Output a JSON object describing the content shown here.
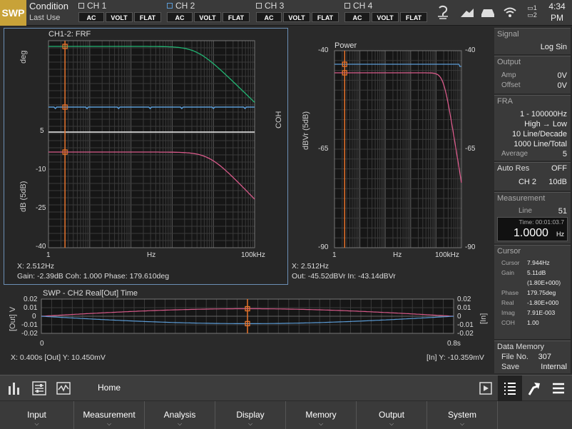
{
  "topbar": {
    "mode": "SWP",
    "condition_title": "Condition",
    "condition_sub": "Last Use",
    "channels": [
      {
        "name": "CH 1",
        "active": false,
        "coupling": "AC",
        "unit": "VOLT",
        "filter": "FLAT"
      },
      {
        "name": "CH 2",
        "active": true,
        "coupling": "AC",
        "unit": "VOLT",
        "filter": "FLAT"
      },
      {
        "name": "CH 3",
        "active": false,
        "coupling": "AC",
        "unit": "VOLT",
        "filter": "FLAT"
      },
      {
        "name": "CH 4",
        "active": false,
        "coupling": "AC",
        "unit": "VOLT",
        "filter": "FLAT"
      }
    ],
    "icons": [
      "usb-icon",
      "signal-icon",
      "storage-icon",
      "wifi-icon",
      "battery-icon"
    ],
    "battery": {
      "b1": "1",
      "b2": "2"
    },
    "time": "4:34",
    "ampm": "PM"
  },
  "frf": {
    "title": "CH1-2: FRF",
    "y_top_label": "deg",
    "y_bottom_label": "dB (5dB)",
    "coh_label": "COH",
    "y_ticks": [
      "5",
      "-10",
      "-25",
      "-40"
    ],
    "x_ticks": [
      "1",
      "Hz",
      "100kHz"
    ],
    "readout_x": "X: 2.512Hz",
    "readout_vals": "Gain: -2.39dB Coh: 1.000 Phase: 179.610deg"
  },
  "power": {
    "title": "Power",
    "y_label": "dBVr (5dB)",
    "y_ticks_left": [
      "-40",
      "-65",
      "-90"
    ],
    "y_ticks_right": [
      "-40",
      "-65",
      "-90"
    ],
    "x_ticks": [
      "1",
      "Hz",
      "100kHz"
    ],
    "readout_x": "X: 2.512Hz",
    "readout_vals": "Out: -45.52dBVr In: -43.14dBVr"
  },
  "time": {
    "title": "SWP - CH2 Real[Out] Time",
    "y_label_left": "[Out] V",
    "y_label_right": "[In]",
    "y_ticks_left": [
      "0.02",
      "0.01",
      "0",
      "-0.01",
      "-0.02"
    ],
    "y_ticks_right": [
      "0.02",
      "0.01",
      "0",
      "-0.01",
      "-0.02"
    ],
    "x_ticks": [
      "0",
      "0.8s"
    ],
    "readout_left": "X: 0.400s [Out] Y: 10.450mV",
    "readout_right": "[In] Y: -10.359mV"
  },
  "sidebar": {
    "signal": {
      "header": "Signal",
      "value": "Log Sin"
    },
    "output": {
      "header": "Output",
      "amp_label": "Amp",
      "amp": "0V",
      "offset_label": "Offset",
      "offset": "0V"
    },
    "fra": {
      "header": "FRA",
      "range": "1 - 100000Hz",
      "direction": "High → Low",
      "density": "10 Line/Decade",
      "total": "1000 Line/Total",
      "average_label": "Average",
      "average": "5"
    },
    "autores": {
      "header": "Auto Res",
      "state": "OFF",
      "ch": "CH 2",
      "range": "10dB"
    },
    "measurement": {
      "header": "Measurement",
      "line_label": "Line",
      "line": "51",
      "time_label": "Time: 00:01:03.7",
      "value": "1.0000",
      "unit": "Hz"
    },
    "cursor": {
      "header": "Cursor",
      "rows": [
        {
          "k": "Cursor",
          "v": "7.944Hz"
        },
        {
          "k": "Gain",
          "v": "5.11dB"
        },
        {
          "k": "",
          "v": "(1.80E+000)"
        },
        {
          "k": "Phase",
          "v": "179.75deg"
        },
        {
          "k": "Real",
          "v": "-1.80E+000"
        },
        {
          "k": "Imag",
          "v": "7.91E-003"
        },
        {
          "k": "COH",
          "v": "1.00"
        }
      ]
    },
    "datamemory": {
      "header": "Data Memory",
      "file_label": "File No.",
      "file": "307",
      "save_label": "Save",
      "save": "Internal"
    }
  },
  "homebar": {
    "label": "Home"
  },
  "menu": [
    "Input",
    "Measurement",
    "Analysis",
    "Display",
    "Memory",
    "Output",
    "System"
  ],
  "colors": {
    "accent": "#c8a238",
    "gain": "#d85a8a",
    "phase": "#22b573",
    "coh": "#5b9bd5",
    "cursor": "#e8742c"
  }
}
